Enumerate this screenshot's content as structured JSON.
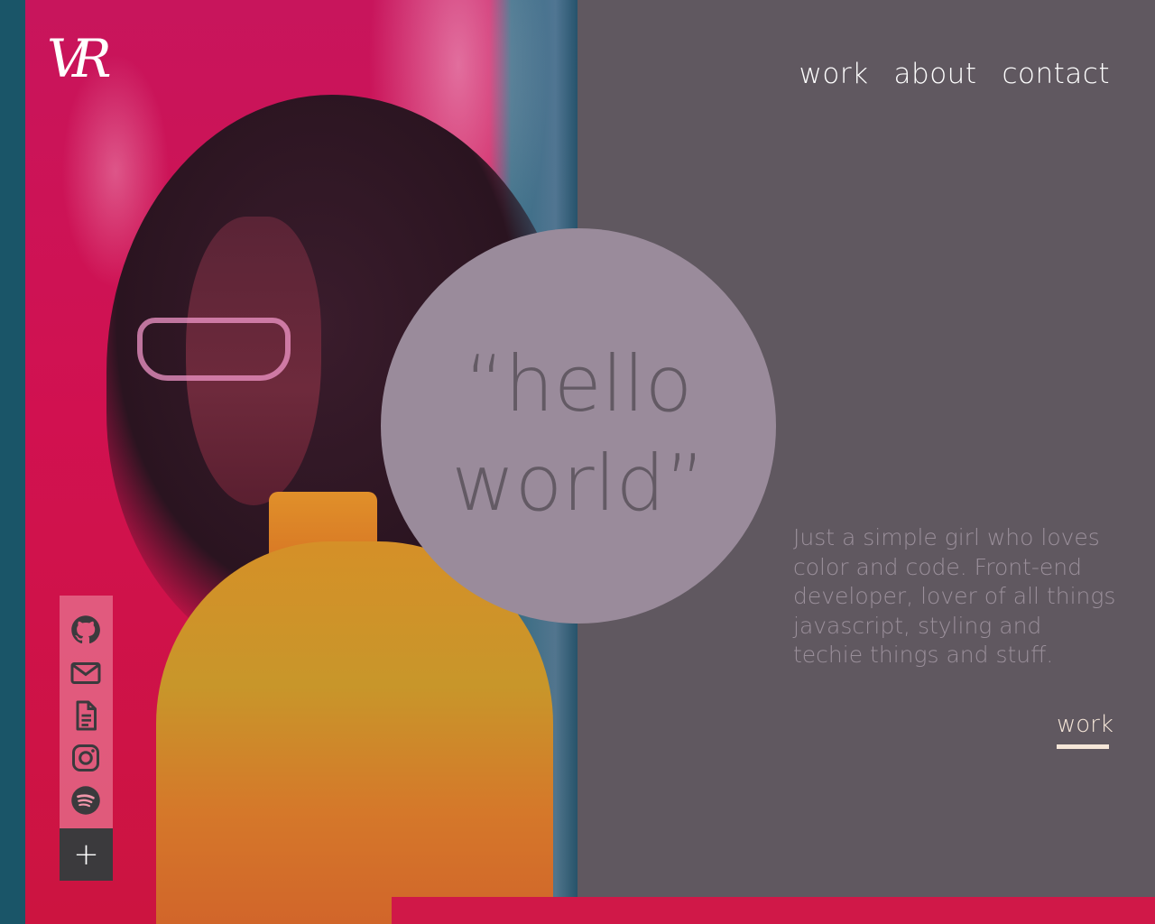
{
  "brand": {
    "logo_text": "VR"
  },
  "nav": {
    "items": [
      "work",
      "about",
      "contact"
    ]
  },
  "hero": {
    "quote_line1": "“hello",
    "quote_line2": "world”"
  },
  "bio": {
    "lines": [
      "Just a simple girl who loves",
      "color and code. Front-end",
      "developer, lover of all things",
      "javascript, styling and",
      "techie things and stuff."
    ]
  },
  "cta": {
    "label": "work"
  },
  "social": {
    "icons": [
      "github-icon",
      "mail-icon",
      "document-icon",
      "instagram-icon",
      "spotify-icon"
    ],
    "toggle_symbol": "+"
  },
  "colors": {
    "left_strip": "#1a5568",
    "panel_bg": "#605860",
    "circle": "#9a8b9b",
    "quote_text": "#635a64",
    "bio_text": "#9a8f9a",
    "cta": "#f5e6d8",
    "accent_bar": "#d01848",
    "social_bg": "#f096aa",
    "toggle_bg": "#3b3a3d"
  }
}
